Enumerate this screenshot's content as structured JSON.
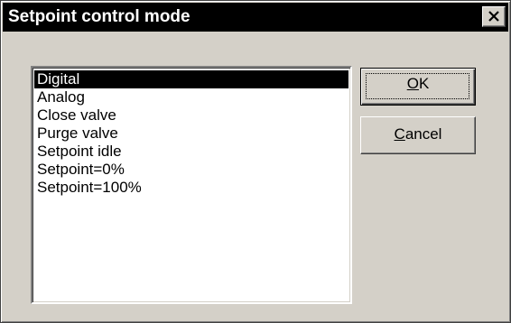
{
  "window": {
    "title": "Setpoint control mode",
    "close_icon": "close-icon"
  },
  "list": {
    "items": [
      {
        "label": "Digital",
        "selected": true
      },
      {
        "label": "Analog",
        "selected": false
      },
      {
        "label": "Close valve",
        "selected": false
      },
      {
        "label": "Purge valve",
        "selected": false
      },
      {
        "label": "Setpoint idle",
        "selected": false
      },
      {
        "label": "Setpoint=0%",
        "selected": false
      },
      {
        "label": "Setpoint=100%",
        "selected": false
      }
    ]
  },
  "buttons": {
    "ok": {
      "accel": "O",
      "rest": "K"
    },
    "cancel": {
      "accel": "C",
      "rest": "ancel"
    }
  },
  "colors": {
    "dialog_bg": "#d4d0c8",
    "titlebar_bg": "#000000",
    "selection_bg": "#000000"
  }
}
